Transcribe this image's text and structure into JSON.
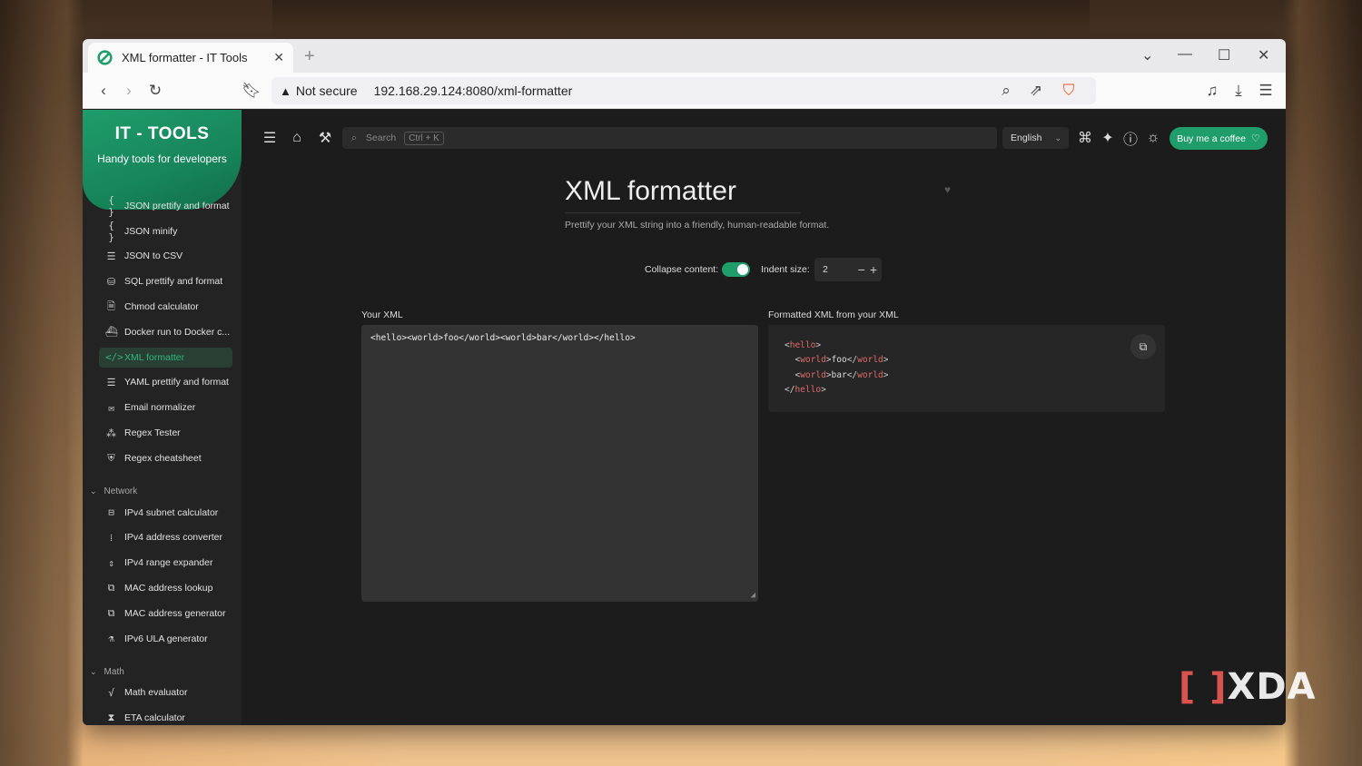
{
  "browser": {
    "tab_title": "XML formatter - IT Tools",
    "not_secure": "Not secure",
    "url": "192.168.29.124:8080/xml-formatter"
  },
  "sidebar": {
    "brand_name": "IT - TOOLS",
    "brand_tagline": "Handy tools for developers",
    "items": [
      {
        "label": "JSON prettify and format",
        "icon": "{ }"
      },
      {
        "label": "JSON minify",
        "icon": "{ }"
      },
      {
        "label": "JSON to CSV",
        "icon": "☰"
      },
      {
        "label": "SQL prettify and format",
        "icon": "⛁"
      },
      {
        "label": "Chmod calculator",
        "icon": "🗎"
      },
      {
        "label": "Docker run to Docker c...",
        "icon": "⛴"
      },
      {
        "label": "XML formatter",
        "icon": "</>"
      },
      {
        "label": "YAML prettify and format",
        "icon": "☰"
      },
      {
        "label": "Email normalizer",
        "icon": "✉"
      },
      {
        "label": "Regex Tester",
        "icon": "⁂"
      },
      {
        "label": "Regex cheatsheet",
        "icon": "⛨"
      }
    ],
    "groups": [
      {
        "name": "Network",
        "items": [
          {
            "label": "IPv4 subnet calculator",
            "icon": "⊟"
          },
          {
            "label": "IPv4 address converter",
            "icon": "⁞"
          },
          {
            "label": "IPv4 range expander",
            "icon": "⇕"
          },
          {
            "label": "MAC address lookup",
            "icon": "⧉"
          },
          {
            "label": "MAC address generator",
            "icon": "⧉"
          },
          {
            "label": "IPv6 ULA generator",
            "icon": "⚗"
          }
        ]
      },
      {
        "name": "Math",
        "items": [
          {
            "label": "Math evaluator",
            "icon": "√"
          },
          {
            "label": "ETA calculator",
            "icon": "⧗"
          }
        ]
      }
    ]
  },
  "topbar": {
    "search_placeholder": "Search",
    "search_shortcut": "Ctrl + K",
    "language": "English",
    "coffee_button": "Buy me a coffee"
  },
  "tool": {
    "title": "XML formatter",
    "description": "Prettify your XML string into a friendly, human-readable format.",
    "collapse_label": "Collapse content:",
    "collapse_on": true,
    "indent_label": "Indent size:",
    "indent_value": "2",
    "input_label": "Your XML",
    "input_value": "<hello><world>foo</world><world>bar</world></hello>",
    "output_label": "Formatted XML from your XML",
    "output_lines": [
      {
        "indent": "",
        "open": "hello",
        "text": "",
        "close": ""
      },
      {
        "indent": "  ",
        "open": "world",
        "text": "foo",
        "close": "world"
      },
      {
        "indent": "  ",
        "open": "world",
        "text": "bar",
        "close": "world"
      },
      {
        "indent": "",
        "open": "",
        "text": "",
        "close": "hello"
      }
    ]
  },
  "colors": {
    "accent": "#1f9d6b",
    "xml_tag": "#e06b6b"
  },
  "watermark": "XDA"
}
